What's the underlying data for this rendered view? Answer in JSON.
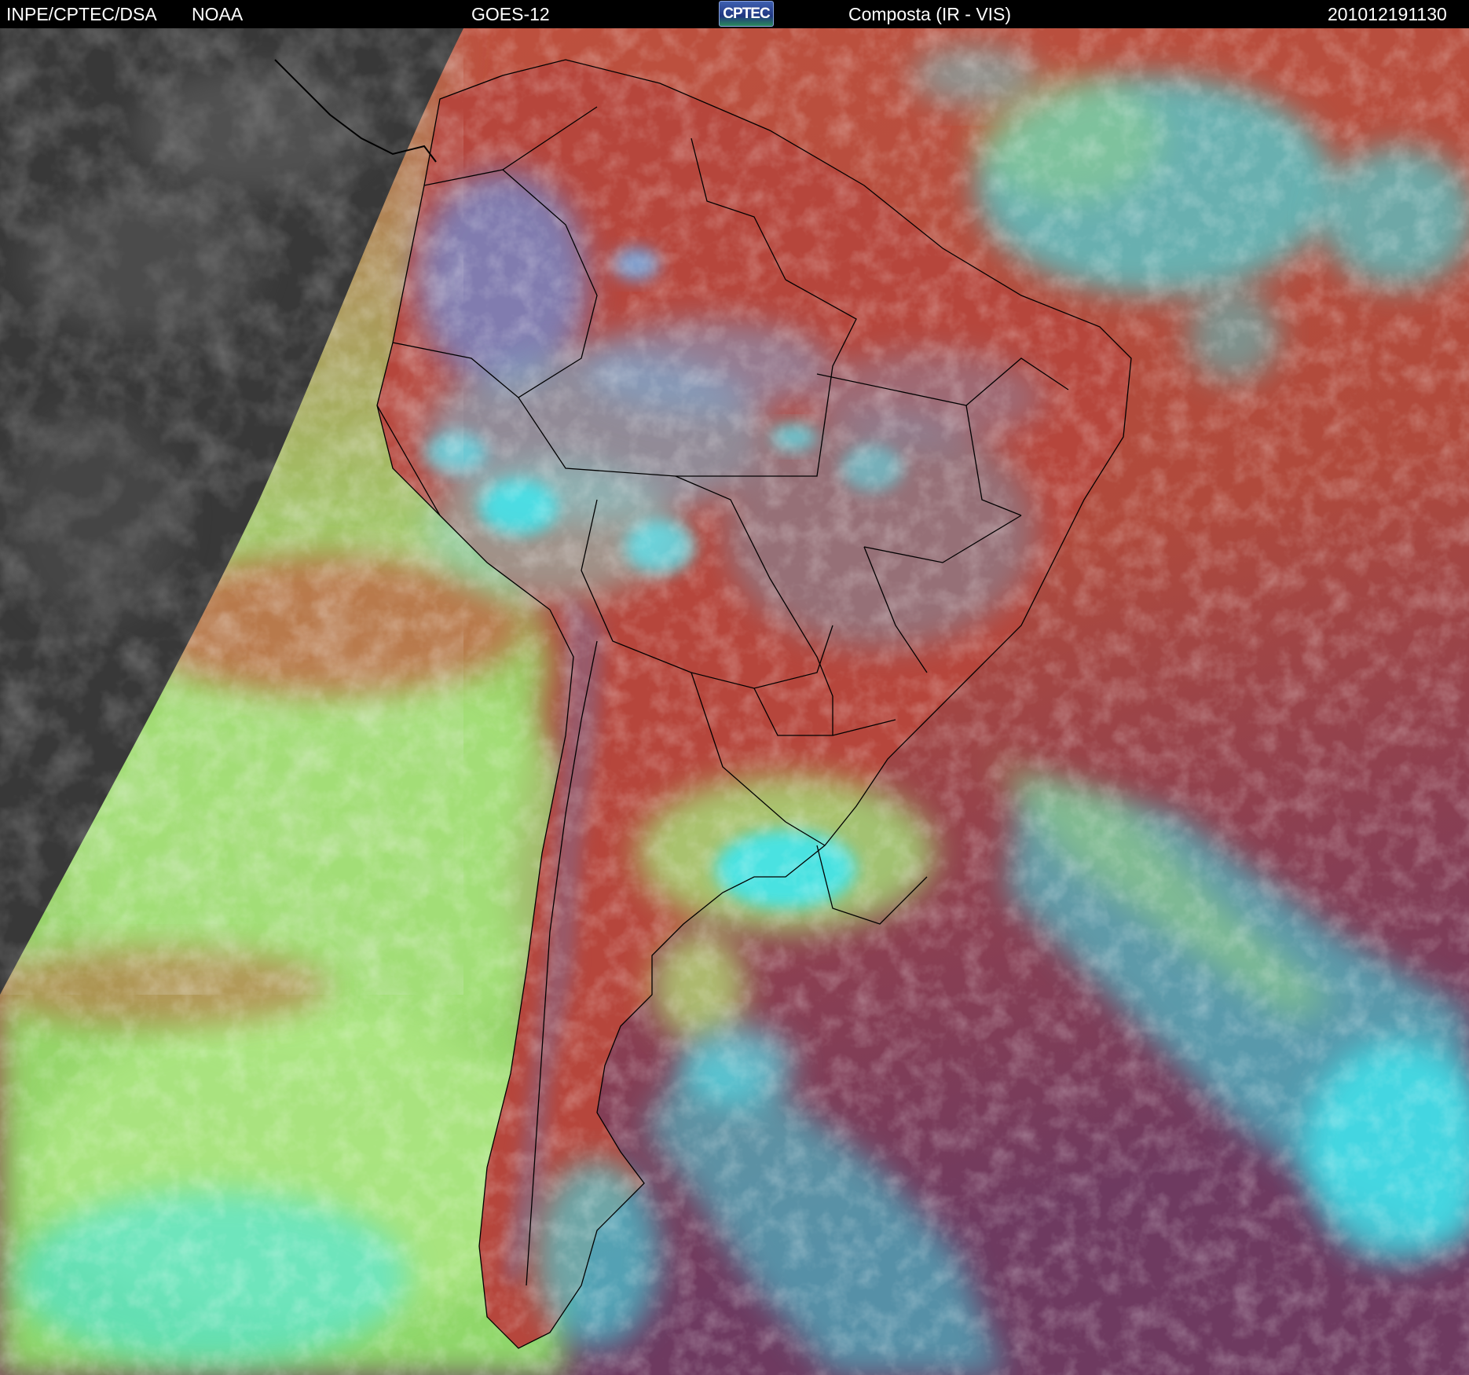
{
  "header": {
    "source": "INPE/CPTEC/DSA",
    "agency": "NOAA",
    "satellite": "GOES-12",
    "logo_text": "CPTEC",
    "product": "Composta (IR - VIS)",
    "timestamp": "201012191130"
  },
  "colors": {
    "night_side": "#3a3a3a",
    "ocean_warm": "#b5473a",
    "ocean_cold_south": "#7c3c5c",
    "low_cloud": "#8fd86a",
    "high_cloud": "#41e6ee",
    "mid_cloud": "#6f8fd6",
    "borders": "#000000"
  }
}
